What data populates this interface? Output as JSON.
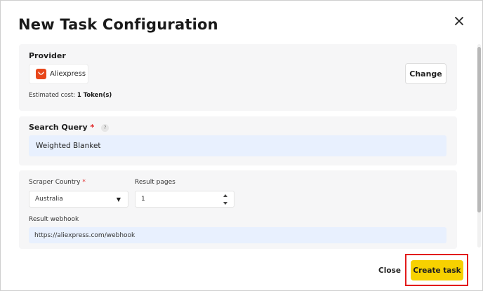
{
  "modal": {
    "title": "New Task Configuration"
  },
  "provider": {
    "label": "Provider",
    "name": "Aliexpress",
    "change_label": "Change",
    "cost_prefix": "Estimated cost:",
    "cost_value": "1 Token(s)",
    "logo_color": "#e8471b"
  },
  "search": {
    "label": "Search Query",
    "required_mark": "*",
    "help_glyph": "?",
    "value": "Weighted Blanket"
  },
  "settings": {
    "country_label": "Scraper Country",
    "country_required_mark": "*",
    "country_value": "Australia",
    "pages_label": "Result pages",
    "pages_value": "1",
    "webhook_label": "Result webhook",
    "webhook_value": "https://aliexpress.com/webhook"
  },
  "footer": {
    "close_label": "Close",
    "create_label": "Create task",
    "primary_color": "#f7d100",
    "highlight_color": "#e21b1b"
  }
}
